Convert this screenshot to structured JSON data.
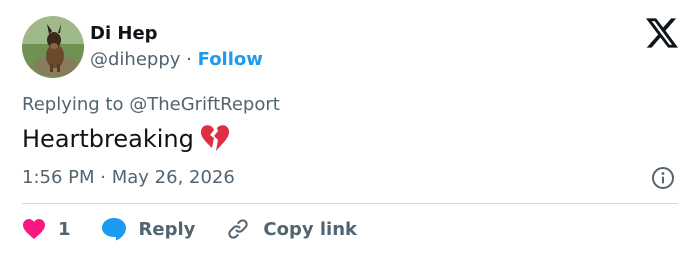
{
  "author": {
    "name": "Di Hep",
    "handle": "@diheppy",
    "separator": "·",
    "follow_label": "Follow",
    "avatar_icon": "dog-photo-avatar"
  },
  "reply_context": {
    "prefix": "Replying to",
    "mention": "@TheGriftReport"
  },
  "tweet": {
    "text": "Heartbreaking",
    "emoji_icon": "broken-heart-icon"
  },
  "timestamp": {
    "time": "1:56 PM",
    "separator": "·",
    "date": "May 26, 2026"
  },
  "actions": {
    "like_count": "1",
    "reply_label": "Reply",
    "copy_link_label": "Copy link"
  },
  "colors": {
    "accent": "#1d9bf0",
    "secondary_text": "#536471",
    "like": "#f91880",
    "broken_heart": "#dd2e44",
    "divider": "#cfd9de"
  }
}
